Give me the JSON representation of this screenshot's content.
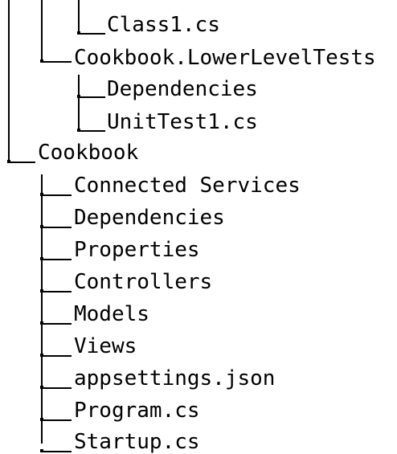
{
  "tree": {
    "nodes": [
      {
        "id": "class1",
        "label": "Class1.cs"
      },
      {
        "id": "lower-level-tests",
        "label": "Cookbook.LowerLevelTests"
      },
      {
        "id": "lower-deps",
        "label": "Dependencies"
      },
      {
        "id": "unittest1",
        "label": "UnitTest1.cs"
      },
      {
        "id": "cookbook",
        "label": "Cookbook"
      },
      {
        "id": "connected-services",
        "label": "Connected Services"
      },
      {
        "id": "dependencies",
        "label": "Dependencies"
      },
      {
        "id": "properties",
        "label": "Properties"
      },
      {
        "id": "controllers",
        "label": "Controllers"
      },
      {
        "id": "models",
        "label": "Models"
      },
      {
        "id": "views",
        "label": "Views"
      },
      {
        "id": "appsettings",
        "label": "appsettings.json"
      },
      {
        "id": "program",
        "label": "Program.cs"
      },
      {
        "id": "startup",
        "label": "Startup.cs"
      }
    ]
  }
}
